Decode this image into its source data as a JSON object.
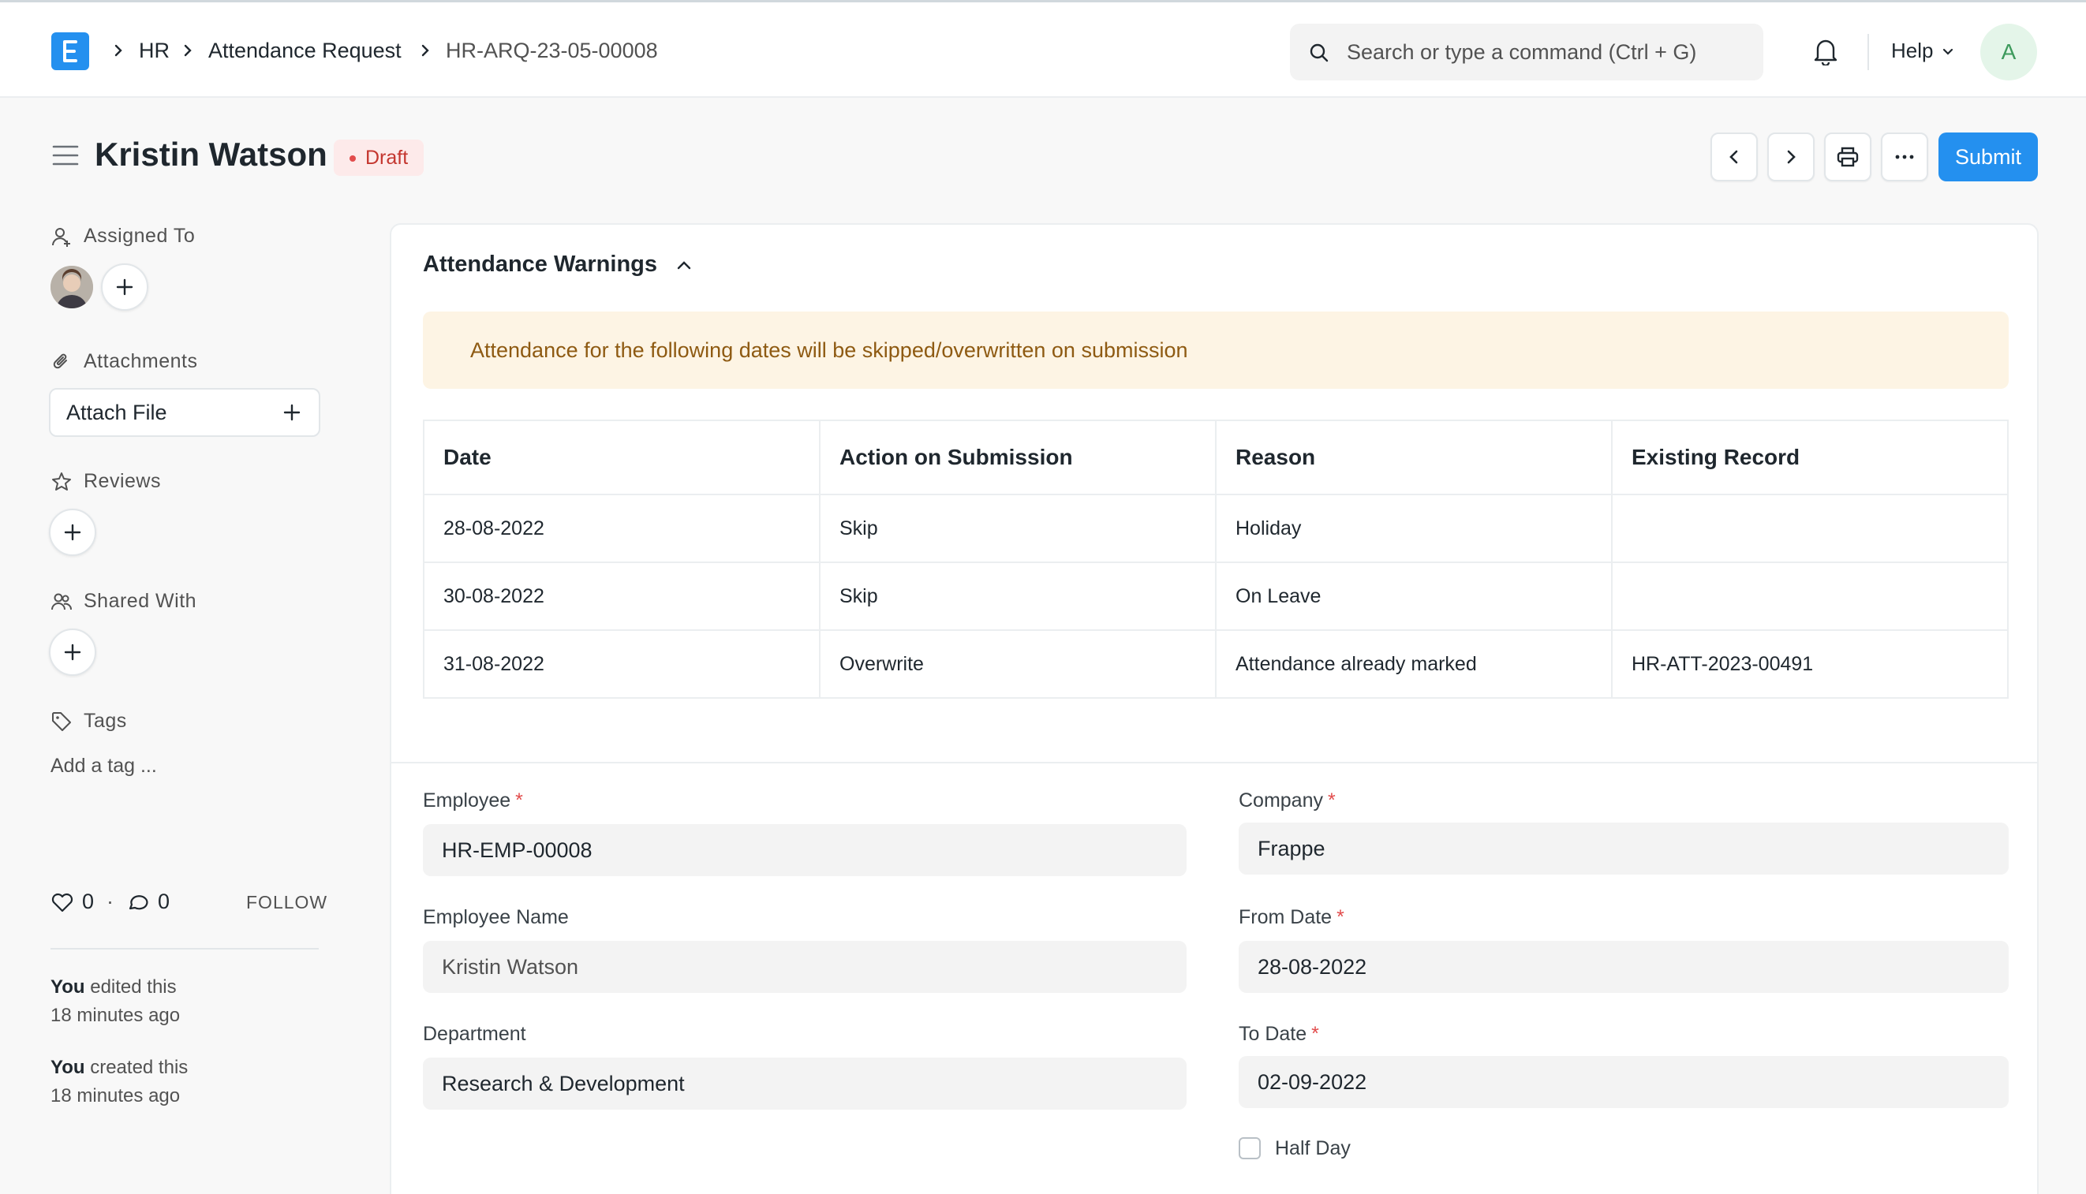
{
  "breadcrumbs": [
    "HR",
    "Attendance Request",
    "HR-ARQ-23-05-00008"
  ],
  "search": {
    "placeholder": "Search or type a command (Ctrl + G)"
  },
  "navbar": {
    "help_label": "Help",
    "avatar_initial": "A"
  },
  "doc": {
    "title": "Kristin Watson",
    "status": "Draft",
    "submit_label": "Submit"
  },
  "sidebar": {
    "assigned_to": "Assigned To",
    "attachments": "Attachments",
    "attach_file": "Attach File",
    "reviews": "Reviews",
    "shared_with": "Shared With",
    "tags": "Tags",
    "add_tag": "Add a tag ...",
    "likes": "0",
    "comments": "0",
    "follow": "FOLLOW",
    "activity": [
      {
        "actor": "You",
        "text": " edited this",
        "time": "18 minutes ago"
      },
      {
        "actor": "You",
        "text": " created this",
        "time": "18 minutes ago"
      }
    ]
  },
  "warnings": {
    "title": "Attendance Warnings",
    "alert": "Attendance for the following dates will be skipped/overwritten on submission",
    "columns": [
      "Date",
      "Action on Submission",
      "Reason",
      "Existing Record"
    ],
    "rows": [
      [
        "28-08-2022",
        "Skip",
        "Holiday",
        ""
      ],
      [
        "30-08-2022",
        "Skip",
        "On Leave",
        ""
      ],
      [
        "31-08-2022",
        "Overwrite",
        "Attendance already marked",
        "HR-ATT-2023-00491"
      ]
    ]
  },
  "form": {
    "employee_label": "Employee",
    "employee": "HR-EMP-00008",
    "employee_name_label": "Employee Name",
    "employee_name": "Kristin Watson",
    "department_label": "Department",
    "department": "Research & Development",
    "company_label": "Company",
    "company": "Frappe",
    "from_date_label": "From Date",
    "from_date": "28-08-2022",
    "to_date_label": "To Date",
    "to_date": "02-09-2022",
    "half_day_label": "Half Day"
  },
  "colors": {
    "primary": "#2490ef",
    "draft": "#c4362f",
    "alert_bg": "#fdf4e4"
  }
}
